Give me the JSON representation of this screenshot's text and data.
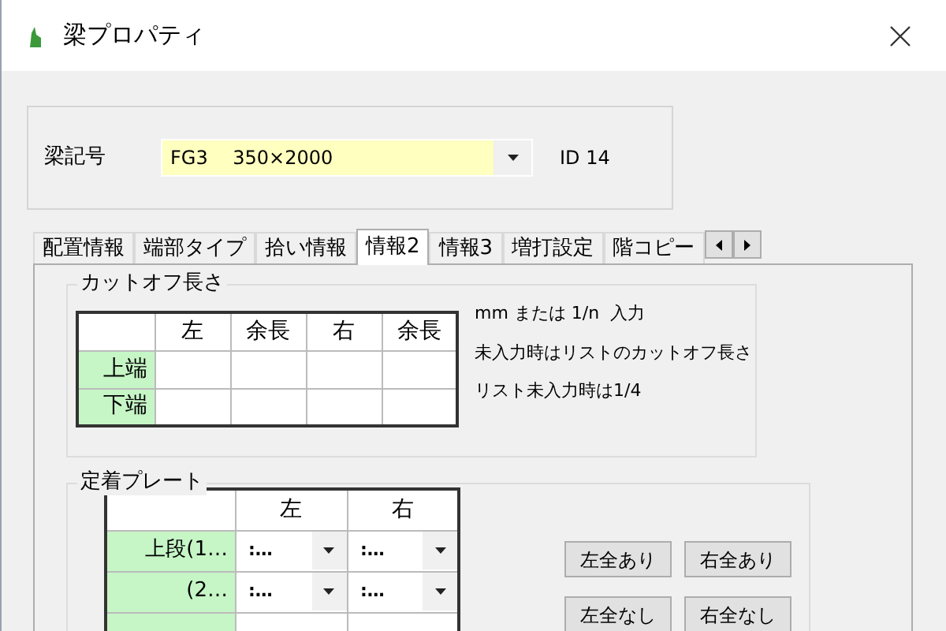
{
  "window": {
    "title": "梁プロパティ"
  },
  "beam_symbol": {
    "label": "梁記号",
    "value": "FG3　 350×2000",
    "id_label": "ID 14"
  },
  "tabs": [
    {
      "label": "配置情報",
      "selected": false
    },
    {
      "label": "端部タイプ",
      "selected": false
    },
    {
      "label": "拾い情報",
      "selected": false
    },
    {
      "label": "情報2",
      "selected": true
    },
    {
      "label": "情報3",
      "selected": false
    },
    {
      "label": "増打設定",
      "selected": false
    },
    {
      "label": "階コピー",
      "selected": false
    }
  ],
  "cutoff": {
    "title": "カットオフ長さ",
    "columns": [
      "左",
      "余長",
      "右",
      "余長"
    ],
    "rows": [
      "上端",
      "下端"
    ],
    "notes": [
      "mm または 1/n  入力",
      "未入力時はリストのカットオフ長さ",
      "リスト未入力時は1/4"
    ]
  },
  "anchor_plate": {
    "title": "定着プレート",
    "columns": [
      "左",
      "右"
    ],
    "rows": [
      {
        "label": "上段(1…",
        "left": ":…",
        "right": ":…"
      },
      {
        "label": "(2…",
        "left": ":…",
        "right": ":…"
      }
    ],
    "buttons": [
      [
        "左全あり",
        "右全あり"
      ],
      [
        "左全なし",
        "右全なし"
      ]
    ]
  }
}
